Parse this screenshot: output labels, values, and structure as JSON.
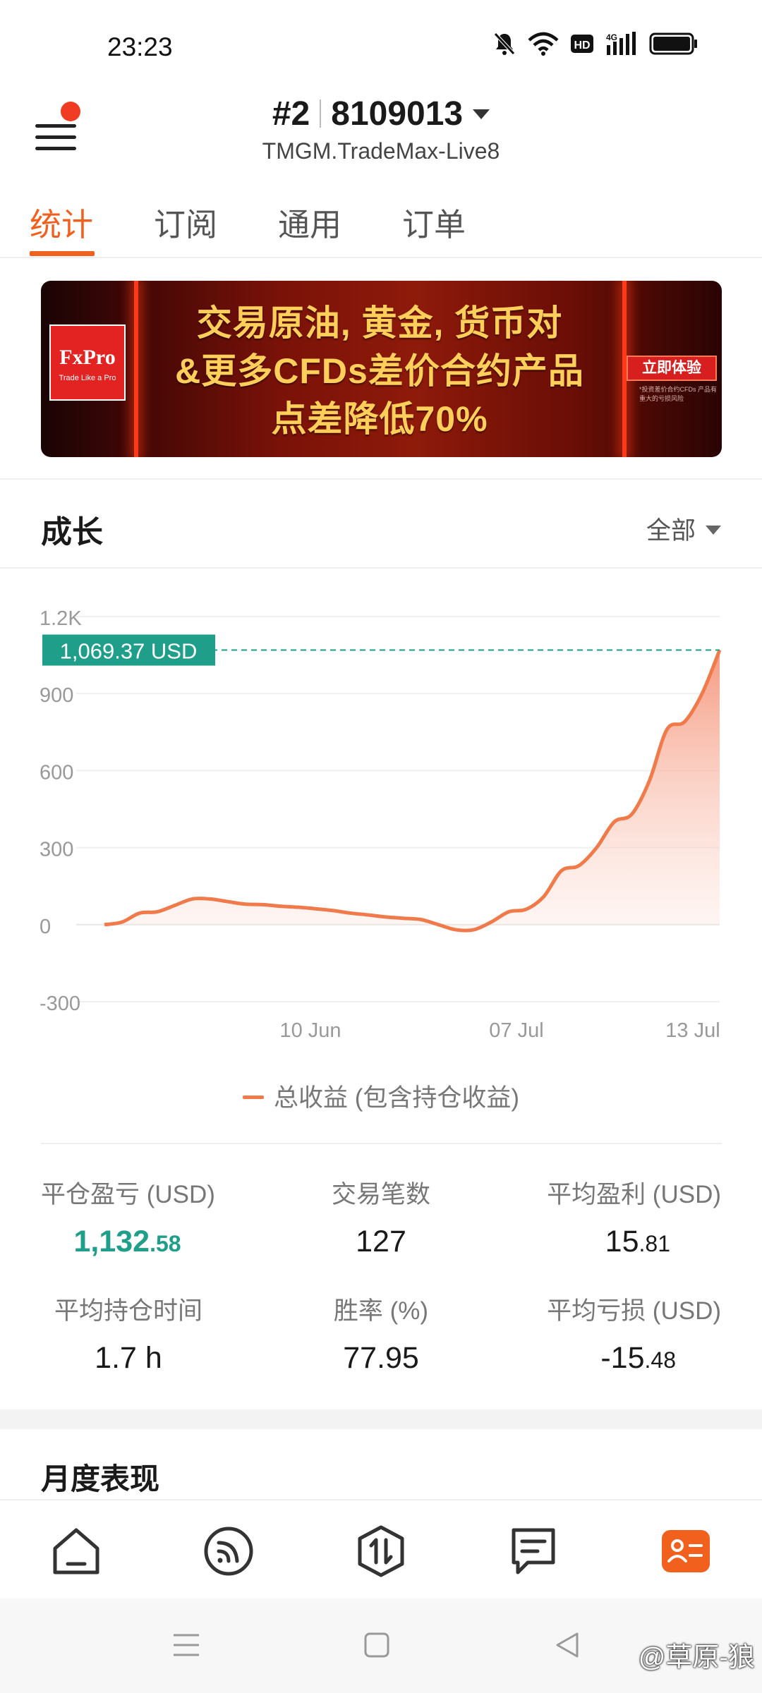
{
  "status_bar": {
    "time": "23:23"
  },
  "header": {
    "account_index": "#2",
    "account_number": "8109013",
    "server": "TMGM.TradeMax-Live8"
  },
  "tabs": [
    {
      "label": "统计",
      "active": true
    },
    {
      "label": "订阅",
      "active": false
    },
    {
      "label": "通用",
      "active": false
    },
    {
      "label": "订单",
      "active": false
    }
  ],
  "banner": {
    "brand": "FxPro",
    "brand_tagline": "Trade Like a Pro",
    "line1": "交易原油, 黄金, 货币对",
    "line2": "&更多CFDs差价合约产品",
    "line3": "点差降低70%",
    "cta": "立即体验",
    "note": "*投资差价合约CFDs 产品有重大的亏损风险"
  },
  "growth": {
    "title": "成长",
    "range": "全部"
  },
  "chart_data": {
    "type": "area",
    "y_ticks": [
      "1.2K",
      "900",
      "600",
      "300",
      "0",
      "-300"
    ],
    "ylim": [
      -300,
      1200
    ],
    "x_ticks": [
      "10 Jun",
      "07 Jul",
      "13 Jul"
    ],
    "current_label": "1,069.37 USD",
    "current_value": 1069.37,
    "series": [
      {
        "name": "总收益 (包含持仓收益)",
        "color": "#f07a4a",
        "values": [
          0,
          10,
          45,
          50,
          75,
          100,
          100,
          90,
          80,
          78,
          72,
          68,
          62,
          55,
          45,
          38,
          30,
          25,
          20,
          0,
          -20,
          -20,
          10,
          50,
          60,
          110,
          210,
          230,
          300,
          400,
          430,
          560,
          760,
          790,
          900,
          1069.37
        ]
      }
    ],
    "grid": true
  },
  "stats": [
    {
      "label": "平仓盈亏 (USD)",
      "int": "1,132",
      "dec": ".58"
    },
    {
      "label": "交易笔数",
      "int": "127",
      "dec": ""
    },
    {
      "label": "平均盈利 (USD)",
      "int": "15",
      "dec": ".81"
    },
    {
      "label": "平均持仓时间",
      "int": "1.7 h",
      "dec": ""
    },
    {
      "label": "胜率 (%)",
      "int": "77.95",
      "dec": ""
    },
    {
      "label": "平均亏损 (USD)",
      "int": "-15",
      "dec": ".48"
    }
  ],
  "monthly": {
    "title": "月度表现"
  },
  "bottom_nav": [
    {
      "icon": "home-icon",
      "active": false
    },
    {
      "icon": "signal-feed-icon",
      "active": false
    },
    {
      "icon": "trade-icon",
      "active": false
    },
    {
      "icon": "chat-icon",
      "active": false
    },
    {
      "icon": "profile-card-icon",
      "active": true
    }
  ],
  "accent_color": "#f2601d",
  "positive_color": "#1f9e8a",
  "watermark": "@草原-狼"
}
